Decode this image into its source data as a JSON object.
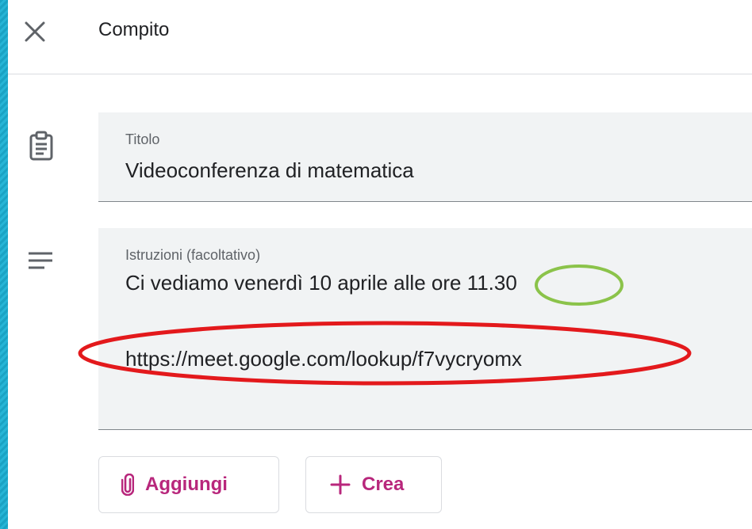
{
  "header": {
    "title": "Compito"
  },
  "title_field": {
    "label": "Titolo",
    "value": "Videoconferenza di matematica"
  },
  "instructions_field": {
    "label": "Istruzioni (facoltativo)",
    "line1_prefix": "Ci vediamo venerdì 10 aprile alle ore ",
    "line1_time": "11.30",
    "link": "https://meet.google.com/lookup/f7vycryomx"
  },
  "buttons": {
    "attach_label": "Aggiungi",
    "create_label": "Crea"
  },
  "icons": {
    "close": "close-icon",
    "assignment": "assignment-icon",
    "notes": "notes-icon",
    "attach": "paperclip-icon",
    "create": "plus-icon"
  },
  "colors": {
    "accent": "#b8277c",
    "annotation_green": "#8bc34a",
    "annotation_red": "#e3191c",
    "background": "#1aa3c4"
  }
}
